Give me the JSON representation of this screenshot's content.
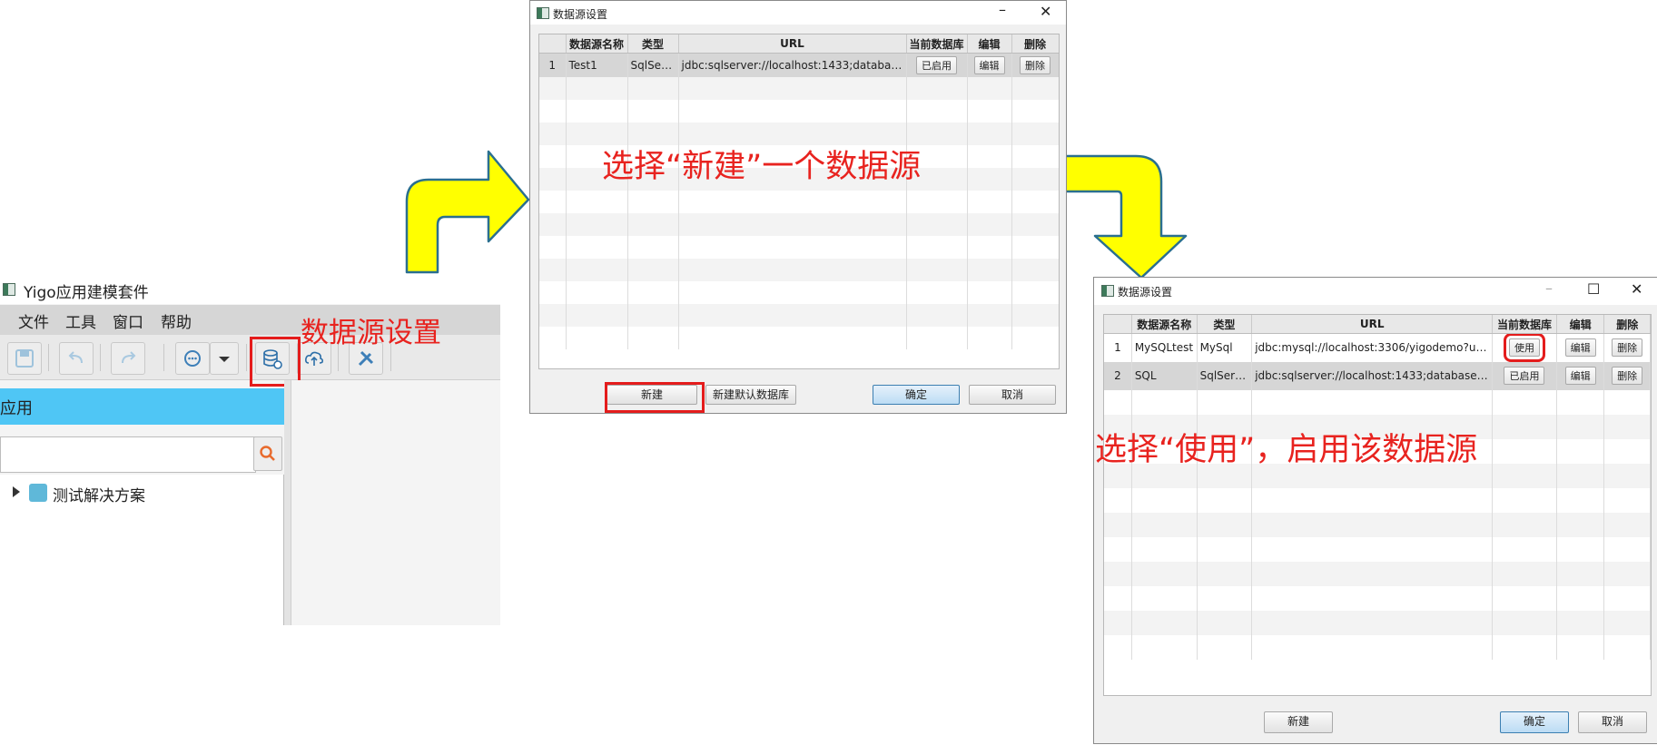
{
  "app": {
    "title": "Yigo应用建模套件",
    "menu": [
      "文件",
      "工具",
      "窗口",
      "帮助"
    ],
    "toolbar_icons": [
      "save-icon",
      "undo-icon",
      "redo-icon",
      "chat-icon",
      "dropdown-icon",
      "datasource-icon",
      "cloud-upload-icon",
      "tools-icon"
    ],
    "panel_title": "应用",
    "search_placeholder": "",
    "tree_root": "测试解决方案"
  },
  "annotations": {
    "datasource_settings": "数据源设置",
    "step1": "选择“新建”一个数据源",
    "step2": "选择“使用”，启用该数据源"
  },
  "dialog1": {
    "title": "数据源设置",
    "columns": [
      "",
      "数据源名称",
      "类型",
      "URL",
      "当前数据库",
      "编辑",
      "删除"
    ],
    "rows": [
      {
        "index": "1",
        "name": "Test1",
        "type": "SqlServer",
        "url": "jdbc:sqlserver://localhost:1433;databaseN...",
        "current": "已启用",
        "edit": "编辑",
        "delete": "删除"
      }
    ],
    "buttons": {
      "new": "新建",
      "new_default": "新建默认数据库",
      "ok": "确定",
      "cancel": "取消"
    }
  },
  "dialog2": {
    "title": "数据源设置",
    "columns": [
      "",
      "数据源名称",
      "类型",
      "URL",
      "当前数据库",
      "编辑",
      "删除"
    ],
    "rows": [
      {
        "index": "1",
        "name": "MySQLtest",
        "type": "MySql",
        "url": "jdbc:mysql://localhost:3306/yigodemo?us...",
        "current": "使用",
        "edit": "编辑",
        "delete": "删除"
      },
      {
        "index": "2",
        "name": "SQL",
        "type": "SqlServer",
        "url": "jdbc:sqlserver://localhost:1433;databaseN...",
        "current": "已启用",
        "edit": "编辑",
        "delete": "删除"
      }
    ],
    "buttons": {
      "new": "新建",
      "ok": "确定",
      "cancel": "取消"
    }
  },
  "colors": {
    "annotation_red": "#e8231f",
    "arrow_yellow": "#ffff00",
    "arrow_outline": "#2a6f8f",
    "panel_blue": "#4fc6f5"
  }
}
